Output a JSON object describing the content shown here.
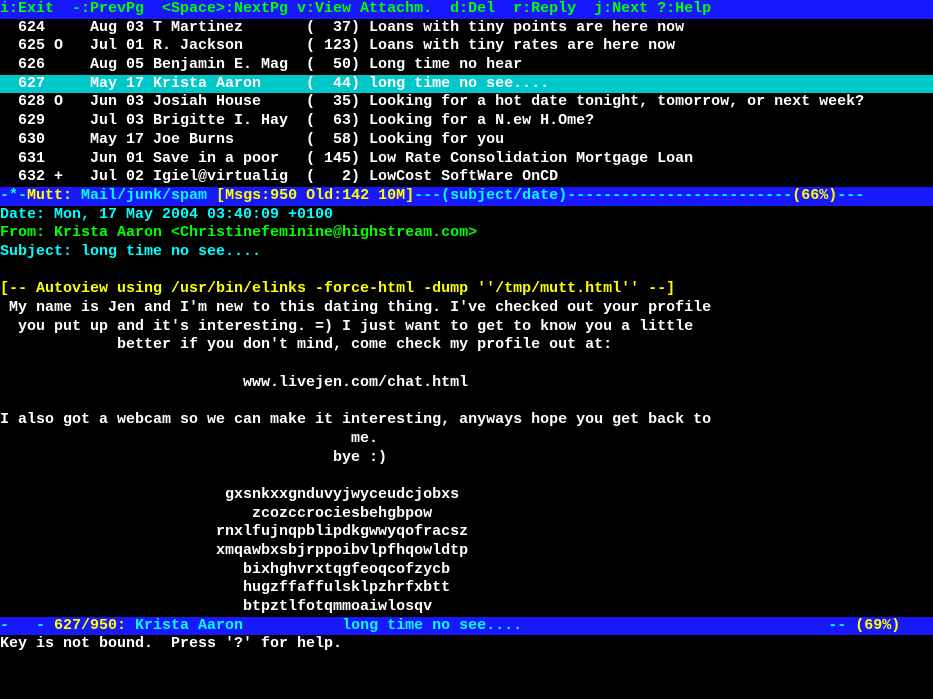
{
  "topbar": {
    "text": "i:Exit  -:PrevPg  <Space>:NextPg v:View Attachm.  d:Del  r:Reply  j:Next ?:Help"
  },
  "messages": [
    {
      "num": "624",
      "flag": " ",
      "date": "Aug 03",
      "from": "T Martinez",
      "size": "37",
      "subj": "Loans with tiny points are here now",
      "sel": false
    },
    {
      "num": "625",
      "flag": "O",
      "date": "Jul 01",
      "from": "R. Jackson",
      "size": "123",
      "subj": "Loans with tiny rates are here now",
      "sel": false
    },
    {
      "num": "626",
      "flag": " ",
      "date": "Aug 05",
      "from": "Benjamin E. Mag",
      "size": "50",
      "subj": "Long time no hear",
      "sel": false
    },
    {
      "num": "627",
      "flag": " ",
      "date": "May 17",
      "from": "Krista Aaron",
      "size": "44",
      "subj": "long time no see....",
      "sel": true
    },
    {
      "num": "628",
      "flag": "O",
      "date": "Jun 03",
      "from": "Josiah House",
      "size": "35",
      "subj": "Looking for a hot date tonight, tomorrow, or next week?",
      "sel": false
    },
    {
      "num": "629",
      "flag": " ",
      "date": "Jul 03",
      "from": "Brigitte I. Hay",
      "size": "63",
      "subj": "Looking for a N.ew H.Ome?",
      "sel": false
    },
    {
      "num": "630",
      "flag": " ",
      "date": "May 17",
      "from": "Joe Burns",
      "size": "58",
      "subj": "Looking for you",
      "sel": false
    },
    {
      "num": "631",
      "flag": " ",
      "date": "Jun 01",
      "from": "Save in a poor",
      "size": "145",
      "subj": "Low Rate Consolidation Mortgage Loan",
      "sel": false
    },
    {
      "num": "632",
      "flag": "+",
      "date": "Jul 02",
      "from": "Igiel@virtualig",
      "size": "2",
      "subj": "LowCost SoftWare OnCD",
      "sel": false
    }
  ],
  "statusbar": {
    "prefix": "-*-",
    "app": "Mutt:",
    "folder": "Mail/junk/spam",
    "stats": "[Msgs:950 Old:142 10M]",
    "sort": "---(subject/date)",
    "dashes": "-------------------------",
    "pct": "(66%)",
    "tail": "---"
  },
  "headers": {
    "date": "Date: Mon, 17 May 2004 03:40:09 +0100",
    "from": "From: Krista Aaron <Christinefeminine@highstream.com>",
    "subject": "Subject: long time no see...."
  },
  "autoview": "[-- Autoview using /usr/bin/elinks -force-html -dump ''/tmp/mutt.html'' --]",
  "body": {
    "l1": " My name is Jen and I'm new to this dating thing. I've checked out your profile",
    "l2": "  you put up and it's interesting. =) I just want to get to know you a little",
    "l3": "             better if you don't mind, come check my profile out at:",
    "l4": "",
    "l5": "                           www.livejen.com/chat.html",
    "l6": "",
    "l7": "I also got a webcam so we can make it interesting, anyways hope you get back to",
    "l8": "                                       me.",
    "l9": "                                     bye :)",
    "l10": "",
    "l11": "                         gxsnkxxgnduvyjwyceudcjobxs",
    "l12": "                            zcozccrociesbehgbpow",
    "l13": "                        rnxlfujnqpblipdkgwwyqofracsz",
    "l14": "                        xmqawbxsbjrppoibvlpfhqowldtp",
    "l15": "                           bixhghvrxtqgfeoqcofzycb",
    "l16": "                           hugzffaffulsklpzhrfxbtt",
    "l17": "                           btpztlfotqmmoaiwlosqv"
  },
  "status2": {
    "left_dash": "-   -",
    "pos": " 627/950: ",
    "from": "Krista Aaron",
    "gap": "           ",
    "subj": "long time no see....",
    "right_dash": "-- ",
    "pct": "(69%)"
  },
  "prompt": "Key is not bound.  Press '?' for help."
}
